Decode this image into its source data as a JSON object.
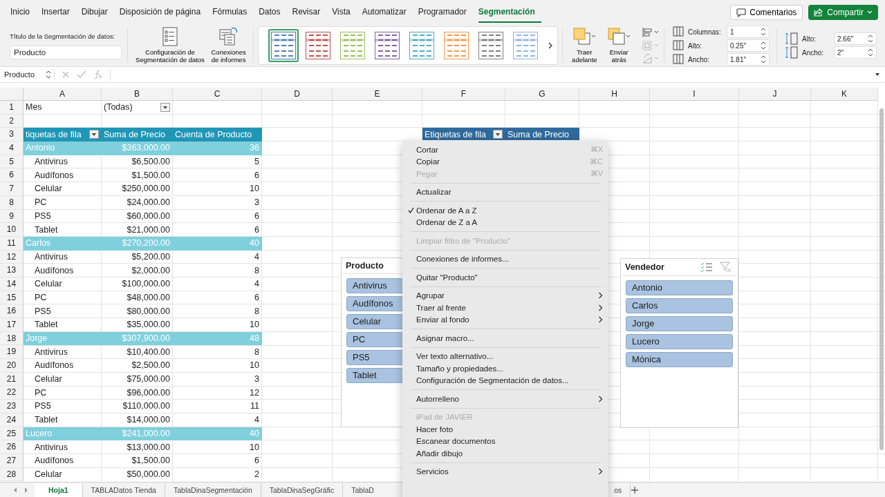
{
  "ribbon_tabs": [
    {
      "label": "Inicio",
      "selected": false
    },
    {
      "label": "Insertar",
      "selected": false
    },
    {
      "label": "Dibujar",
      "selected": false
    },
    {
      "label": "Disposición de página",
      "selected": false
    },
    {
      "label": "Fórmulas",
      "selected": false
    },
    {
      "label": "Datos",
      "selected": false
    },
    {
      "label": "Revisar",
      "selected": false
    },
    {
      "label": "Vista",
      "selected": false
    },
    {
      "label": "Automatizar",
      "selected": false
    },
    {
      "label": "Programador",
      "selected": false
    },
    {
      "label": "Segmentación",
      "selected": true
    }
  ],
  "top_buttons": {
    "comments": "Comentarios",
    "share": "Compartir"
  },
  "ribbon": {
    "caption_label": "Título de la Segmentación de datos:",
    "caption_value": "Producto",
    "settings_button": "Configuración de Segmentación de datos",
    "connections_button": "Conexiones de informes",
    "styles": [
      {
        "color": "#4f7fb8",
        "selected": true
      },
      {
        "color": "#c0504d",
        "selected": false
      },
      {
        "color": "#9bbb59",
        "selected": false
      },
      {
        "color": "#8064a2",
        "selected": false
      },
      {
        "color": "#4bacc6",
        "selected": false
      },
      {
        "color": "#f79646",
        "selected": false
      },
      {
        "color": "#7f7f7f",
        "selected": false
      },
      {
        "color": "#8db4e2",
        "selected": false
      }
    ],
    "bring_forward": "Traer adelante",
    "send_backward": "Enviar atrás",
    "button_fields": [
      {
        "label": "Columnas:",
        "value": "1"
      },
      {
        "label": "Alto:",
        "value": "0.25\""
      },
      {
        "label": "Ancho:",
        "value": "1.81\""
      }
    ],
    "size_fields": [
      {
        "label": "Alto:",
        "value": "2.66\""
      },
      {
        "label": "Ancho:",
        "value": "2\""
      }
    ]
  },
  "formula_bar": {
    "name_box": "Producto"
  },
  "grid": {
    "columns": [
      "A",
      "B",
      "C",
      "D",
      "E",
      "F",
      "G",
      "H",
      "I",
      "J",
      "K"
    ],
    "row_numbers": [
      "1",
      "2",
      "3",
      "4",
      "5",
      "6",
      "7",
      "8",
      "9",
      "10",
      "11",
      "12",
      "13",
      "14",
      "15",
      "16",
      "17",
      "18",
      "19",
      "20",
      "21",
      "22",
      "23",
      "24",
      "25",
      "26",
      "27",
      "28"
    ]
  },
  "filter": {
    "label": "Mes",
    "value": "(Todas)"
  },
  "pivot": {
    "headers": [
      "tiquetas de fila",
      "Suma de Precio",
      "Cuenta de Producto"
    ],
    "rows": [
      {
        "kind": "group",
        "label": "Antonio",
        "sum": "$363,000.00",
        "count": "36"
      },
      {
        "kind": "item",
        "label": "Antivirus",
        "sum": "$6,500.00",
        "count": "5"
      },
      {
        "kind": "item",
        "label": "Audífonos",
        "sum": "$1,500.00",
        "count": "6"
      },
      {
        "kind": "item",
        "label": "Celular",
        "sum": "$250,000.00",
        "count": "10"
      },
      {
        "kind": "item",
        "label": "PC",
        "sum": "$24,000.00",
        "count": "3"
      },
      {
        "kind": "item",
        "label": "PS5",
        "sum": "$60,000.00",
        "count": "6"
      },
      {
        "kind": "item",
        "label": "Tablet",
        "sum": "$21,000.00",
        "count": "6"
      },
      {
        "kind": "group",
        "label": "Carlos",
        "sum": "$270,200.00",
        "count": "40"
      },
      {
        "kind": "item",
        "label": "Antivirus",
        "sum": "$5,200.00",
        "count": "4"
      },
      {
        "kind": "item",
        "label": "Audífonos",
        "sum": "$2,000.00",
        "count": "8"
      },
      {
        "kind": "item",
        "label": "Celular",
        "sum": "$100,000.00",
        "count": "4"
      },
      {
        "kind": "item",
        "label": "PC",
        "sum": "$48,000.00",
        "count": "6"
      },
      {
        "kind": "item",
        "label": "PS5",
        "sum": "$80,000.00",
        "count": "8"
      },
      {
        "kind": "item",
        "label": "Tablet",
        "sum": "$35,000.00",
        "count": "10"
      },
      {
        "kind": "group",
        "label": "Jorge",
        "sum": "$307,900.00",
        "count": "48"
      },
      {
        "kind": "item",
        "label": "Antivirus",
        "sum": "$10,400.00",
        "count": "8"
      },
      {
        "kind": "item",
        "label": "Audífonos",
        "sum": "$2,500.00",
        "count": "10"
      },
      {
        "kind": "item",
        "label": "Celular",
        "sum": "$75,000.00",
        "count": "3"
      },
      {
        "kind": "item",
        "label": "PC",
        "sum": "$96,000.00",
        "count": "12"
      },
      {
        "kind": "item",
        "label": "PS5",
        "sum": "$110,000.00",
        "count": "11"
      },
      {
        "kind": "item",
        "label": "Tablet",
        "sum": "$14,000.00",
        "count": "4"
      },
      {
        "kind": "group",
        "label": "Lucero",
        "sum": "$241,000.00",
        "count": "40"
      },
      {
        "kind": "item",
        "label": "Antivirus",
        "sum": "$13,000.00",
        "count": "10"
      },
      {
        "kind": "item",
        "label": "Audífonos",
        "sum": "$1,500.00",
        "count": "6"
      },
      {
        "kind": "item",
        "label": "Celular",
        "sum": "$50,000.00",
        "count": "2"
      }
    ]
  },
  "pivot2": {
    "headers": [
      "Etiquetas de fila",
      "Suma de Precio"
    ]
  },
  "slicers": [
    {
      "title": "Producto",
      "items": [
        {
          "label": "Antivirus",
          "selected": true
        },
        {
          "label": "Audífonos",
          "selected": true
        },
        {
          "label": "Celular",
          "selected": true
        },
        {
          "label": "PC",
          "selected": true
        },
        {
          "label": "PS5",
          "selected": true
        },
        {
          "label": "Tablet",
          "selected": true
        }
      ]
    },
    {
      "title": "Vendedor",
      "items": [
        {
          "label": "Antonio",
          "selected": true
        },
        {
          "label": "Carlos",
          "selected": true
        },
        {
          "label": "Jorge",
          "selected": true
        },
        {
          "label": "Lucero",
          "selected": true
        },
        {
          "label": "Mónica",
          "selected": true
        }
      ]
    }
  ],
  "context_menu": [
    [
      {
        "label": "Cortar",
        "shortcut": "⌘X",
        "checked": false,
        "disabled": false,
        "submenu": false
      },
      {
        "label": "Copiar",
        "shortcut": "⌘C",
        "checked": false,
        "disabled": false,
        "submenu": false
      },
      {
        "label": "Pegar",
        "shortcut": "⌘V",
        "checked": false,
        "disabled": true,
        "submenu": false
      }
    ],
    [
      {
        "label": "Actualizar",
        "checked": false,
        "disabled": false,
        "submenu": false
      }
    ],
    [
      {
        "label": "Ordenar de A a Z",
        "checked": true,
        "disabled": false,
        "submenu": false
      },
      {
        "label": "Ordenar de Z a A",
        "checked": false,
        "disabled": false,
        "submenu": false
      }
    ],
    [
      {
        "label": "Limpiar filtro de \"Producto\"",
        "checked": false,
        "disabled": true,
        "submenu": false
      }
    ],
    [
      {
        "label": "Conexiones de informes...",
        "checked": false,
        "disabled": false,
        "submenu": false
      }
    ],
    [
      {
        "label": "Quitar \"Producto\"",
        "checked": false,
        "disabled": false,
        "submenu": false
      }
    ],
    [
      {
        "label": "Agrupar",
        "checked": false,
        "disabled": false,
        "submenu": true
      },
      {
        "label": "Traer al frente",
        "checked": false,
        "disabled": false,
        "submenu": true
      },
      {
        "label": "Enviar al fondo",
        "checked": false,
        "disabled": false,
        "submenu": true
      }
    ],
    [
      {
        "label": "Asignar macro...",
        "checked": false,
        "disabled": false,
        "submenu": false
      }
    ],
    [
      {
        "label": "Ver texto alternativo...",
        "checked": false,
        "disabled": false,
        "submenu": false
      },
      {
        "label": "Tamaño y propiedades...",
        "checked": false,
        "disabled": false,
        "submenu": false
      },
      {
        "label": "Configuración de Segmentación de datos...",
        "checked": false,
        "disabled": false,
        "submenu": false
      }
    ],
    [
      {
        "label": "Autorrelleno",
        "checked": false,
        "disabled": false,
        "submenu": true
      }
    ],
    [
      {
        "label": "iPad de JAVIER",
        "checked": false,
        "disabled": true,
        "submenu": false
      },
      {
        "label": "Hacer foto",
        "checked": false,
        "disabled": false,
        "submenu": false
      },
      {
        "label": "Escanear documentos",
        "checked": false,
        "disabled": false,
        "submenu": false
      },
      {
        "label": "Añadir dibujo",
        "checked": false,
        "disabled": false,
        "submenu": false
      }
    ],
    [
      {
        "label": "Servicios",
        "checked": false,
        "disabled": false,
        "submenu": true
      }
    ]
  ],
  "sheet_tabs": [
    {
      "label": "Hoja1",
      "selected": true
    },
    {
      "label": "TABLADatos Tienda",
      "selected": false
    },
    {
      "label": "TablaDinaSegmentación",
      "selected": false
    },
    {
      "label": "TablaDinaSegGráfic",
      "selected": false
    },
    {
      "label": "TablaD",
      "selected": false
    },
    {
      "label": "os",
      "selected": false
    }
  ]
}
